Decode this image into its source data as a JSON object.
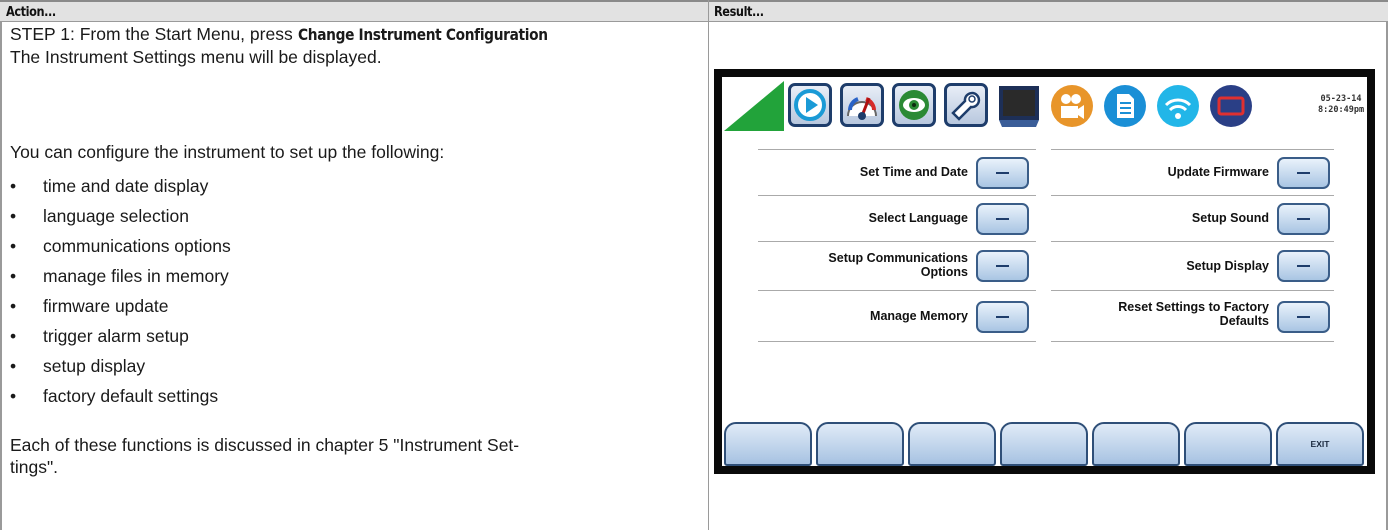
{
  "header": {
    "action": "Action...",
    "result": "Result..."
  },
  "left": {
    "step_prefix": "STEP 1: From the Start Menu, press ",
    "step_button": "Change Instrument Configuration",
    "step_suffix": ".",
    "line2": "The Instrument Settings menu will be displayed.",
    "intro": "You can configure the instrument to set up the following:",
    "bullets": [
      "time and date display",
      "language selection",
      "communications options",
      "manage files in memory",
      "firmware update",
      "trigger alarm setup",
      "setup display",
      "factory default settings"
    ],
    "bullet_glyph": "•",
    "footer_line1": "Each of these functions is discussed in chapter 5 \"Instrument Set-",
    "footer_line2": "tings\"."
  },
  "screen": {
    "date": "05-23-14",
    "time": "8:20:49pm",
    "icons": [
      "status-triangle-icon",
      "play-icon",
      "gauge-icon",
      "eye-icon",
      "wrench-icon",
      "monitor-icon",
      "camera-icon",
      "document-icon",
      "wifi-icon",
      "rectangle-icon"
    ],
    "colors": {
      "triangle": "#22a33a",
      "button_border": "#3a5d88",
      "camera": "#e8952a",
      "document": "#1a8fd6",
      "wifi": "#22b6e8",
      "rect": "#2a3f86"
    },
    "menu_left": [
      {
        "label": "Set Time and Date",
        "button": "–"
      },
      {
        "label": "Select Language",
        "button": "–"
      },
      {
        "label": "Setup Communications\nOptions",
        "label_l1": "Setup Communications",
        "label_l2": "Options",
        "button": "–"
      },
      {
        "label": "Manage Memory",
        "button": "–"
      }
    ],
    "menu_right": [
      {
        "label": "Update Firmware",
        "button": "–"
      },
      {
        "label": "Setup Sound",
        "button": "–"
      },
      {
        "label": "Setup Display",
        "button": "–"
      },
      {
        "label_l1": "Reset Settings to Factory",
        "label_l2": "Defaults",
        "button": "–"
      }
    ],
    "softkeys": [
      "",
      "",
      "",
      "",
      "",
      "",
      "EXIT"
    ]
  }
}
